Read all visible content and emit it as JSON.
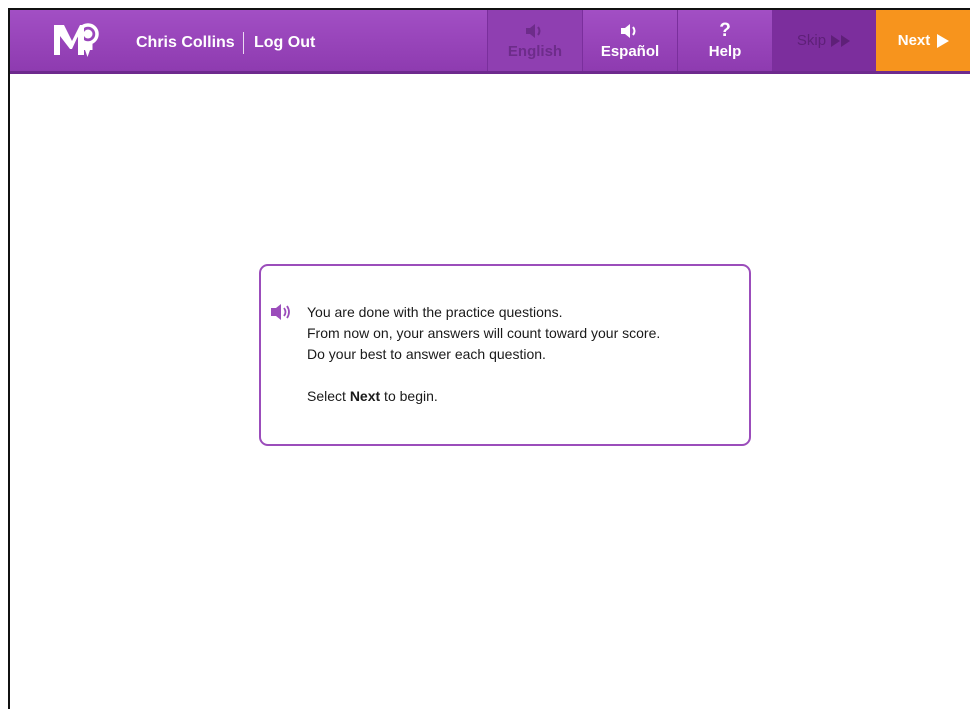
{
  "header": {
    "logo_text": "M",
    "user_name": "Chris Collins",
    "logout_label": "Log Out",
    "tools": {
      "english": {
        "label": "English",
        "icon": "speaker-icon",
        "disabled": true
      },
      "espanol": {
        "label": "Español",
        "icon": "speaker-icon"
      },
      "help": {
        "label": "Help",
        "icon": "question-mark-icon",
        "symbol": "?"
      },
      "skip": {
        "label": "Skip",
        "icon": "double-arrow-icon",
        "disabled": true
      },
      "next": {
        "label": "Next",
        "icon": "play-arrow-icon"
      }
    }
  },
  "dialog": {
    "icon": "speaker-icon",
    "lines": [
      "You are done with the practice questions.",
      "From now on, your answers will count toward your score.",
      "Do your best to answer each question."
    ],
    "cta_prefix": "Select ",
    "cta_bold": "Next",
    "cta_suffix": " to begin."
  },
  "colors": {
    "header_purple": "#9a48bc",
    "next_orange": "#f7941d",
    "dialog_border": "#9b4dbb"
  }
}
